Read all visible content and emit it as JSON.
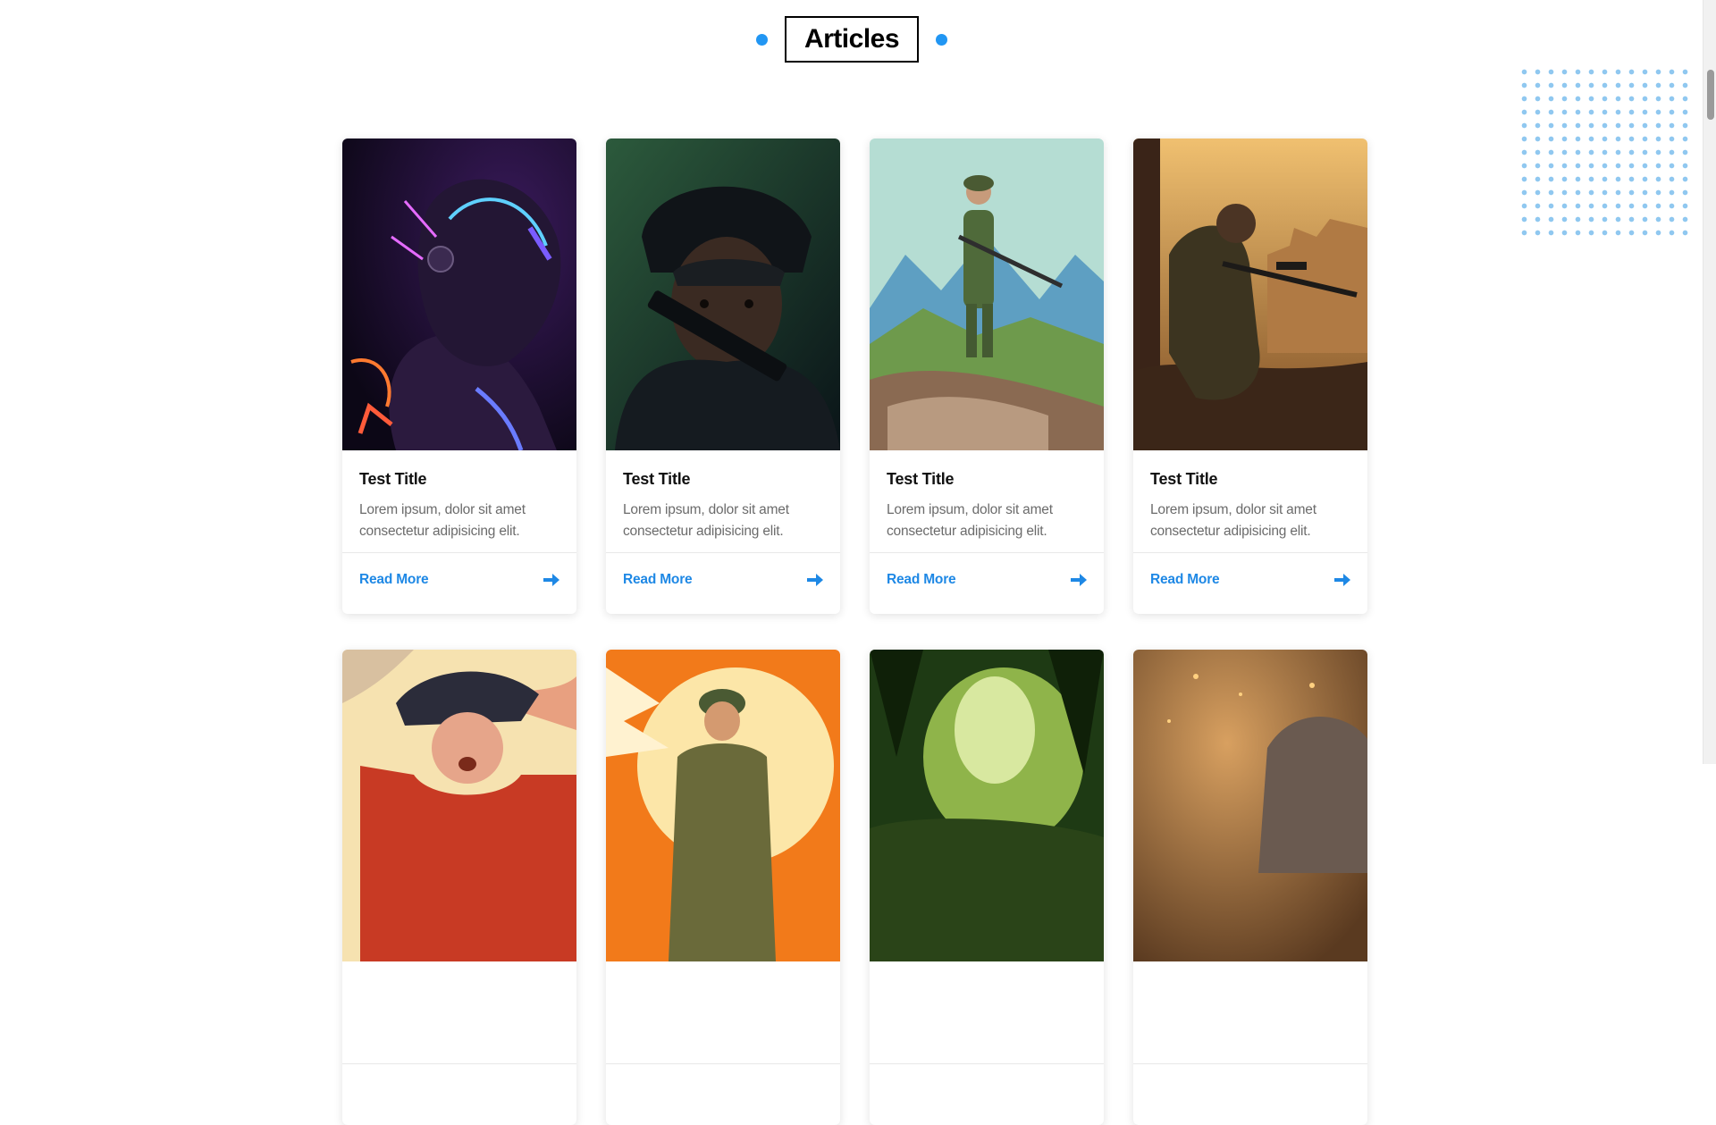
{
  "section": {
    "title": "Articles",
    "accent_color": "#2196f3"
  },
  "cards": [
    {
      "title": "Test Title",
      "text": "Lorem ipsum, dolor sit amet consectetur adipisicing elit.",
      "link": "Read More",
      "image": "neon-armored-helmet-figure"
    },
    {
      "title": "Test Title",
      "text": "Lorem ipsum, dolor sit amet consectetur adipisicing elit.",
      "link": "Read More",
      "image": "soldier-dark-helmet-rifle"
    },
    {
      "title": "Test Title",
      "text": "Lorem ipsum, dolor sit amet consectetur adipisicing elit.",
      "link": "Read More",
      "image": "soldier-on-mountain-rocks"
    },
    {
      "title": "Test Title",
      "text": "Lorem ipsum, dolor sit amet consectetur adipisicing elit.",
      "link": "Read More",
      "image": "sniper-in-ruined-city"
    },
    {
      "title": "",
      "text": "",
      "link": "",
      "image": "colonial-officer-tricorn-hat"
    },
    {
      "title": "",
      "text": "",
      "link": "",
      "image": "soldier-orange-sunburst"
    },
    {
      "title": "",
      "text": "",
      "link": "",
      "image": "jungle-green-scene"
    },
    {
      "title": "",
      "text": "",
      "link": "",
      "image": "creature-in-embers"
    }
  ]
}
